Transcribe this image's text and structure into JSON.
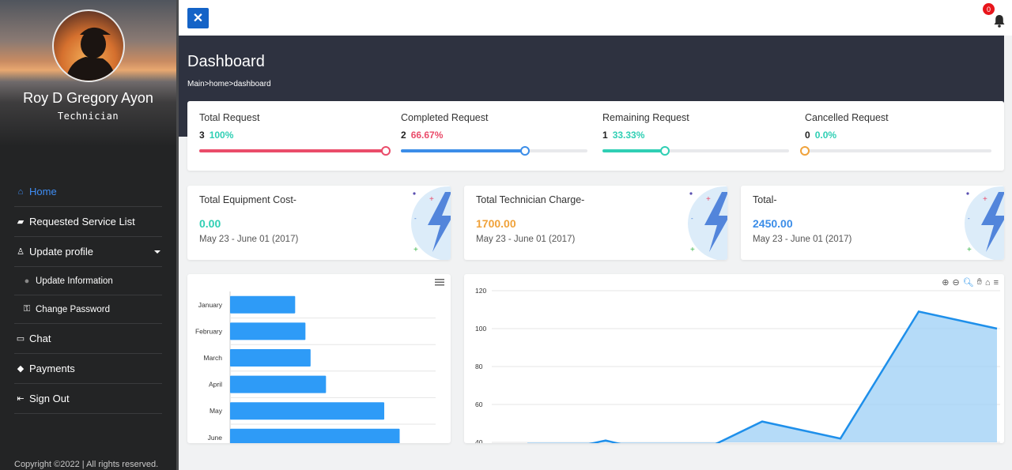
{
  "user": {
    "name": "Roy D Gregory Ayon",
    "role": "Technician"
  },
  "nav": {
    "home": "Home",
    "requested": "Requested Service List",
    "update_profile": "Update profile",
    "update_info": "Update Information",
    "change_password": "Change Password",
    "chat": "Chat",
    "payments": "Payments",
    "sign_out": "Sign Out"
  },
  "footer": {
    "copyright": "Copyright ©2022 | All rights reserved."
  },
  "topbar": {
    "notification_count": "0"
  },
  "header": {
    "title": "Dashboard",
    "breadcrumb": "Main>home>dashboard"
  },
  "stats": [
    {
      "label": "Total Request",
      "count": "3",
      "percent": "100%",
      "fraction": 1.0,
      "color": "#ea4c6a",
      "percent_color": "#2fcfb4"
    },
    {
      "label": "Completed Request",
      "count": "2",
      "percent": "66.67%",
      "fraction": 0.6667,
      "color": "#3b8de8",
      "percent_color": "#ea4c6a"
    },
    {
      "label": "Remaining Request",
      "count": "1",
      "percent": "33.33%",
      "fraction": 0.3333,
      "color": "#2fcfb4",
      "percent_color": "#2fcfb4"
    },
    {
      "label": "Cancelled Request",
      "count": "0",
      "percent": "0.0%",
      "fraction": 0.0,
      "color": "#f0a23a",
      "percent_color": "#2fcfb4"
    }
  ],
  "summary": [
    {
      "label": "Total Equipment Cost-",
      "value": "0.00",
      "date": "May 23 - June 01 (2017)",
      "color": "#2fcfb4"
    },
    {
      "label": "Total Technician Charge-",
      "value": "1700.00",
      "date": "May 23 - June 01 (2017)",
      "color": "#f0a23a"
    },
    {
      "label": "Total-",
      "value": "2450.00",
      "date": "May 23 - June 01 (2017)",
      "color": "#3b8de8"
    }
  ],
  "chart_data": [
    {
      "type": "bar",
      "orientation": "horizontal",
      "categories": [
        "January",
        "February",
        "March",
        "April",
        "May",
        "June"
      ],
      "values": [
        38,
        44,
        47,
        56,
        90,
        99
      ],
      "xlim": [
        0,
        120
      ],
      "color": "#2e9bf7"
    },
    {
      "type": "area",
      "yticks": [
        40,
        60,
        80,
        100,
        120
      ],
      "ylim": [
        40,
        120
      ],
      "x": [
        0,
        1,
        2,
        3,
        4,
        5,
        6
      ],
      "values": [
        32,
        41,
        31,
        51,
        42,
        109,
        100
      ],
      "color": "#1e8fea"
    }
  ],
  "colors": {
    "accent": "#1463c7",
    "header": "#2e3240",
    "sidebar": "#232425"
  }
}
